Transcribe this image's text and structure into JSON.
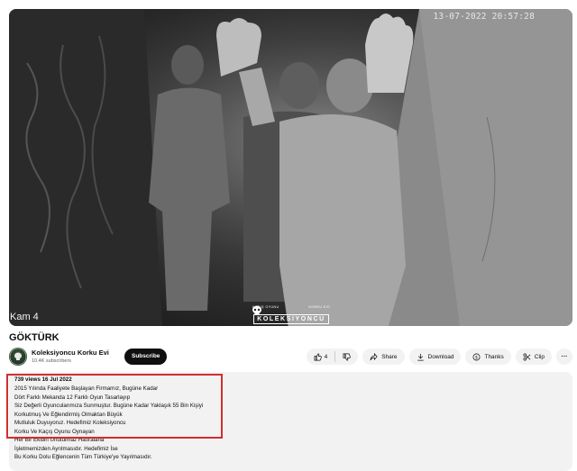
{
  "video": {
    "timestamp": "13-07-2022  20:57:28",
    "camera_label": "Kam 4",
    "watermark_small_left": "KAÇIŞ OYUNU",
    "watermark_small_right": "KORKU EVİ",
    "watermark_brand": "KOLEKSIYONCU"
  },
  "title": "GÖKTÜRK",
  "channel": {
    "name": "Koleksiyoncu Korku Evi",
    "subscribers": "10.4K subscribers",
    "subscribe_label": "Subscribe"
  },
  "actions": {
    "like_count": "4",
    "share_label": "Share",
    "download_label": "Download",
    "thanks_label": "Thanks",
    "clip_label": "Clip",
    "more_label": "···"
  },
  "description": {
    "meta": "739 views  16 Jul 2022",
    "lines": [
      "2015 Yılında Faaliyete Başlayan Firmamız, Bugüne Kadar",
      "Dört Farklı Mekanda 12 Farklı Oyun Tasarlayıp",
      "Siz Değerli Oyuncularımıza Sunmuştur. Bugüne Kadar Yaklaşık 55 Bin Kişiyi",
      "Korkutmuş Ve Eğlendirmiş Olmaktan Büyük",
      "Mutluluk Duyuyoruz. Hedefimiz Koleksiyoncu",
      "Korku Ve Kaçış Oyunu Oynayan",
      "Her Bir Ekibin Unutulmaz Hatıralarla",
      "İşletmemizden Ayrılmasıdır. Hedefimiz İse",
      "Bu Korku Dolu Eğlencenin Tüm Türkiye'ye Yayılmasıdır."
    ]
  },
  "colors": {
    "highlight_border": "#d42d2d",
    "subscribe_bg": "#0f0f0f",
    "pill_bg": "#f2f2f2",
    "desc_bg": "#f2f2f2"
  }
}
